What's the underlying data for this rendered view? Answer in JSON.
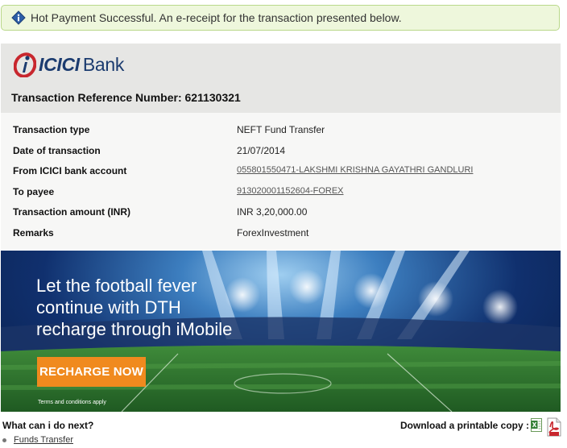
{
  "alert": {
    "message": "Hot Payment Successful. An e-receipt for the transaction presented below."
  },
  "header": {
    "logo_text": "ICICI",
    "logo_bank": "Bank",
    "reference_label": "Transaction Reference Number:",
    "reference_number": "621130321"
  },
  "details": [
    {
      "label": "Transaction type",
      "value": "NEFT Fund Transfer"
    },
    {
      "label": "Date of transaction",
      "value": "21/07/2014"
    },
    {
      "label": "From ICICI bank account",
      "value": "055801550471-LAKSHMI KRISHNA GAYATHRI GANDLURI"
    },
    {
      "label": "To payee",
      "value": "913020001152604-FOREX"
    },
    {
      "label": "Transaction amount (INR)",
      "value": "INR 3,20,000.00"
    },
    {
      "label": "Remarks",
      "value": "ForexInvestment"
    }
  ],
  "banner": {
    "headline": "Let the football fever\ncontinue with DTH\nrecharge through iMobile",
    "button_label": "RECHARGE NOW",
    "terms": "Terms and conditions apply"
  },
  "footer": {
    "next_title": "What can i do next?",
    "next_items": [
      "Funds Transfer"
    ],
    "download_label": "Download a printable copy :"
  },
  "colors": {
    "brand": "#1b3b6f",
    "logo_accent": "#c8272e",
    "button": "#f08a1e",
    "alert_bg": "#eef7dc"
  },
  "icons": [
    "info-icon",
    "excel-icon",
    "pdf-icon"
  ]
}
